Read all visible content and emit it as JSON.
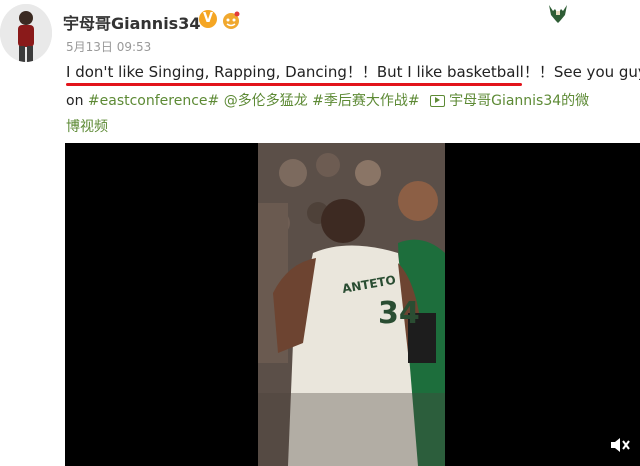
{
  "header": {
    "username": "宇母哥Giannis34",
    "verified_badge": "V",
    "timestamp": "5月13日 09:53"
  },
  "post": {
    "line1": "I don't like Singing, Rapping, Dancing！！But I like basketball！！See you guys",
    "line2_prefix": "on",
    "hashtag1": "#eastconference#",
    "mention": "@多伦多猛龙",
    "hashtag2": "#季后赛大作战#",
    "video_link_1": "宇母哥Giannis34的微",
    "video_link_2": "博视频"
  },
  "video": {
    "jersey_number": "34",
    "jersey_name": "ANTETO"
  },
  "colors": {
    "link": "#5d8a35",
    "underline": "#e2141b",
    "verified": "#f5a623"
  },
  "icons": [
    "avatar",
    "verified-badge-icon",
    "vip-icon",
    "team-logo-icon",
    "video-link-icon",
    "mute-icon"
  ]
}
